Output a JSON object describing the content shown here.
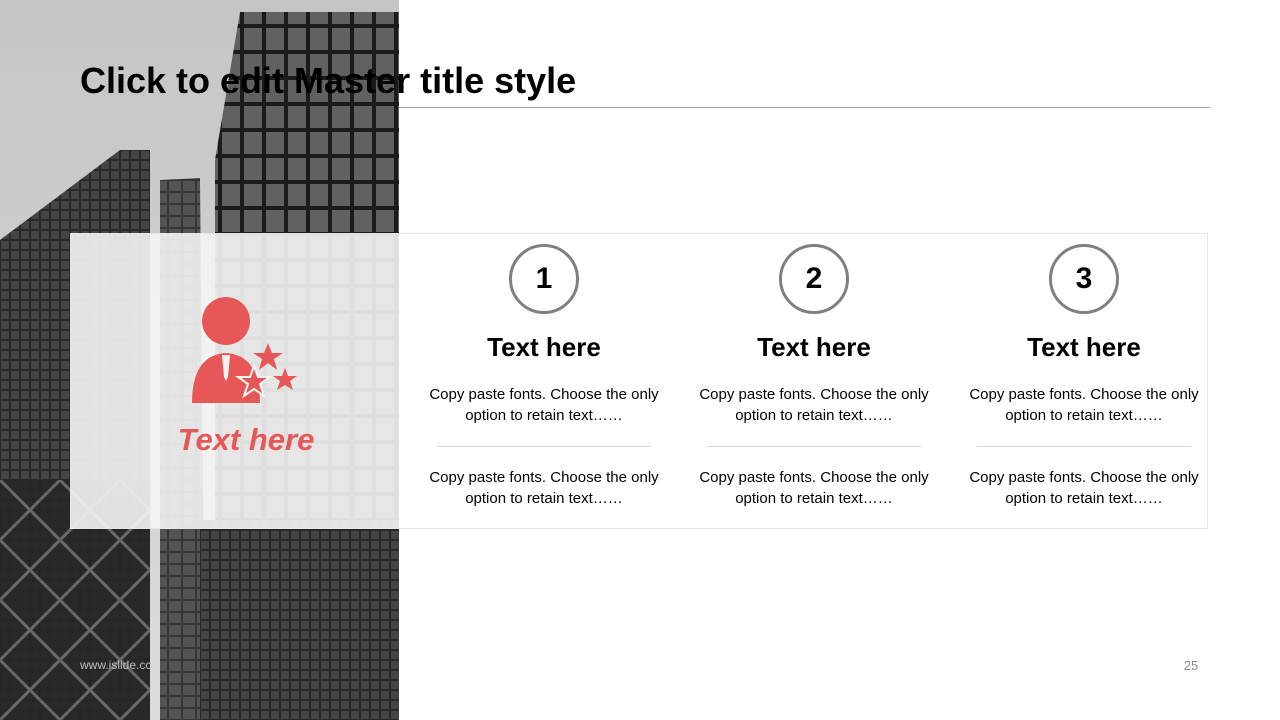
{
  "slide": {
    "title": "Click to edit Master title style",
    "left_label": "Text here",
    "footer_url": "www.islide.cc",
    "page_number": "25"
  },
  "columns": [
    {
      "number": "1",
      "heading": "Text here",
      "text1": "Copy paste fonts. Choose the only option to retain text……",
      "text2": "Copy paste fonts. Choose the only option to retain text……"
    },
    {
      "number": "2",
      "heading": "Text here",
      "text1": "Copy paste fonts. Choose the only option to retain text……",
      "text2": "Copy paste fonts. Choose the only option to retain text……"
    },
    {
      "number": "3",
      "heading": "Text here",
      "text1": "Copy paste fonts. Choose the only option to retain text……",
      "text2": "Copy paste fonts. Choose the only option to retain text……"
    }
  ],
  "colors": {
    "accent": "#e85757",
    "circle_border": "#7f7f7f"
  },
  "icons": {
    "left_icon": "person-with-stars-icon"
  }
}
